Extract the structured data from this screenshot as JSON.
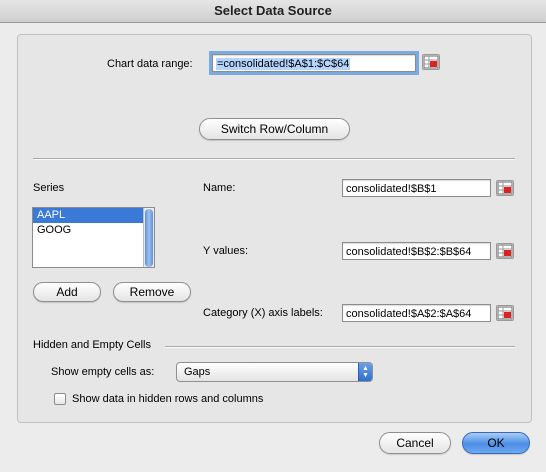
{
  "window": {
    "title": "Select Data Source"
  },
  "chart_range": {
    "label": "Chart data range:",
    "value": "=consolidated!$A$1:$C$64"
  },
  "switch_button": "Switch Row/Column",
  "series": {
    "label": "Series",
    "items": [
      "AAPL",
      "GOOG"
    ],
    "selected": "AAPL",
    "add_label": "Add",
    "remove_label": "Remove"
  },
  "fields": {
    "name_label": "Name:",
    "name_value": "consolidated!$B$1",
    "y_label": "Y values:",
    "y_value": "consolidated!$B$2:$B$64",
    "cat_label": "Category (X) axis labels:",
    "cat_value": "consolidated!$A$2:$A$64"
  },
  "hidden": {
    "heading": "Hidden and Empty Cells",
    "show_empty_label": "Show empty cells as:",
    "show_empty_value": "Gaps",
    "checkbox_label": "Show data in hidden rows and columns"
  },
  "footer": {
    "cancel": "Cancel",
    "ok": "OK"
  },
  "icons": {
    "range_picker": "range-picker-icon",
    "select_arrows": "select-arrows-icon"
  }
}
